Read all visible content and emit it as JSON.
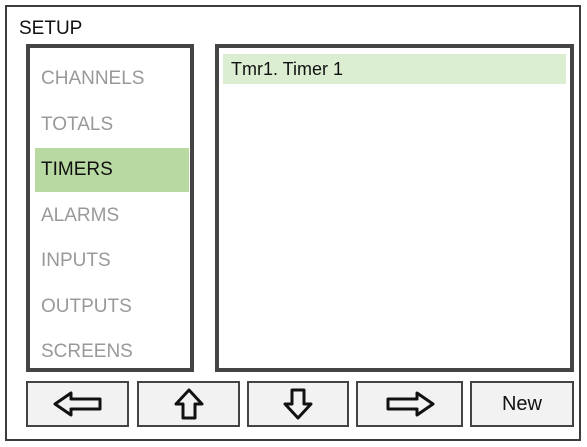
{
  "header": {
    "title": "SETUP"
  },
  "menu": {
    "items": [
      {
        "label": "CHANNELS",
        "active": false
      },
      {
        "label": "TOTALS",
        "active": false
      },
      {
        "label": "TIMERS",
        "active": true
      },
      {
        "label": "ALARMS",
        "active": false
      },
      {
        "label": "INPUTS",
        "active": false
      },
      {
        "label": "OUTPUTS",
        "active": false
      },
      {
        "label": "SCREENS",
        "active": false
      }
    ]
  },
  "list": {
    "items": [
      {
        "label": "Tmr1. Timer 1",
        "selected": true
      }
    ]
  },
  "toolbar": {
    "left_icon": "arrow-left-icon",
    "up_icon": "arrow-up-icon",
    "down_icon": "arrow-down-icon",
    "right_icon": "arrow-right-icon",
    "new_label": "New"
  },
  "colors": {
    "active_menu": "#b9d9a3",
    "selected_row": "#dceed2",
    "inactive_text": "#999999",
    "border": "#444444"
  }
}
